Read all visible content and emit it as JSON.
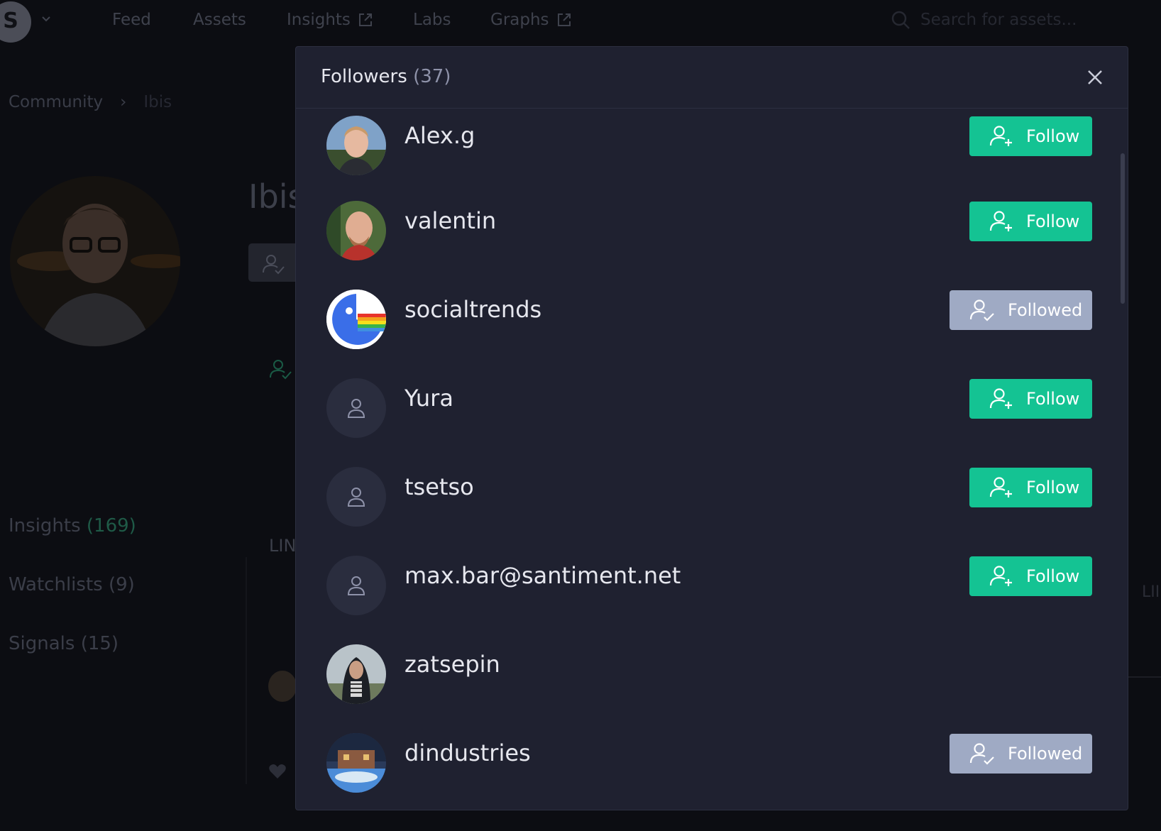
{
  "nav": {
    "logo": "S",
    "items": [
      {
        "label": "Feed",
        "external": false
      },
      {
        "label": "Assets",
        "external": false
      },
      {
        "label": "Insights",
        "external": true
      },
      {
        "label": "Labs",
        "external": false
      },
      {
        "label": "Graphs",
        "external": true
      }
    ],
    "search_placeholder": "Search for assets..."
  },
  "breadcrumb": {
    "root": "Community",
    "separator": "›",
    "current": "Ibis"
  },
  "profile": {
    "name": "Ibis"
  },
  "side_tabs": [
    {
      "label": "Insights",
      "count": "(169)"
    },
    {
      "label": "Watchlists",
      "count": "(9)"
    },
    {
      "label": "Signals",
      "count": "(15)"
    }
  ],
  "background_text": {
    "lin_left": "LIN",
    "lin_right": "LII"
  },
  "modal": {
    "title": "Followers",
    "count": "(37)",
    "followers": [
      {
        "name": "Alex.g",
        "avatar": "photo",
        "button": "Follow"
      },
      {
        "name": "valentin",
        "avatar": "photo",
        "button": "Follow"
      },
      {
        "name": "socialtrends",
        "avatar": "rainbow-logo",
        "button": "Followed"
      },
      {
        "name": "Yura",
        "avatar": "placeholder",
        "button": "Follow"
      },
      {
        "name": "tsetso",
        "avatar": "placeholder",
        "button": "Follow"
      },
      {
        "name": "max.bar@santiment.net",
        "avatar": "placeholder",
        "button": "Follow"
      },
      {
        "name": "zatsepin",
        "avatar": "photo",
        "button": ""
      },
      {
        "name": "dindustries",
        "avatar": "photo",
        "button": "Followed"
      }
    ]
  },
  "colors": {
    "follow": "#14c393",
    "followed": "#9faac4",
    "modal_bg": "#1f2130",
    "page_bg": "#0c0d12"
  },
  "icons": {
    "follow": "user-plus-icon",
    "followed": "user-check-icon",
    "placeholder": "user-icon",
    "close": "close-icon",
    "search": "search-icon",
    "external": "external-link-icon"
  }
}
